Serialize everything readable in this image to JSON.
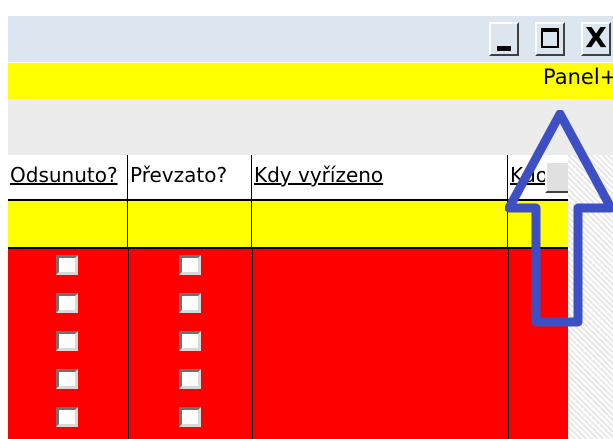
{
  "window": {
    "buttons": {
      "minimize_icon": "minimize-icon",
      "maximize_icon": "maximize-icon",
      "close_glyph": "X"
    }
  },
  "panel": {
    "label": "Panel+"
  },
  "grid": {
    "columns": [
      {
        "label": "Odsunuto?",
        "underlined": true
      },
      {
        "label": "Převzato?",
        "underlined": false
      },
      {
        "label": "Kdy vyřízeno",
        "underlined": true
      },
      {
        "label": "Kdo",
        "underlined": true
      }
    ],
    "rows": [
      {
        "odsunuto": false,
        "prevzato": false
      },
      {
        "odsunuto": false,
        "prevzato": false
      },
      {
        "odsunuto": false,
        "prevzato": false
      },
      {
        "odsunuto": false,
        "prevzato": false
      },
      {
        "odsunuto": false,
        "prevzato": false
      }
    ],
    "colors": {
      "filter_row": "#ffff00",
      "data_rows": "#ff0000"
    }
  },
  "annotation": {
    "arrow_color": "#3d4fc4",
    "arrow_icon": "up-arrow-annotation"
  }
}
